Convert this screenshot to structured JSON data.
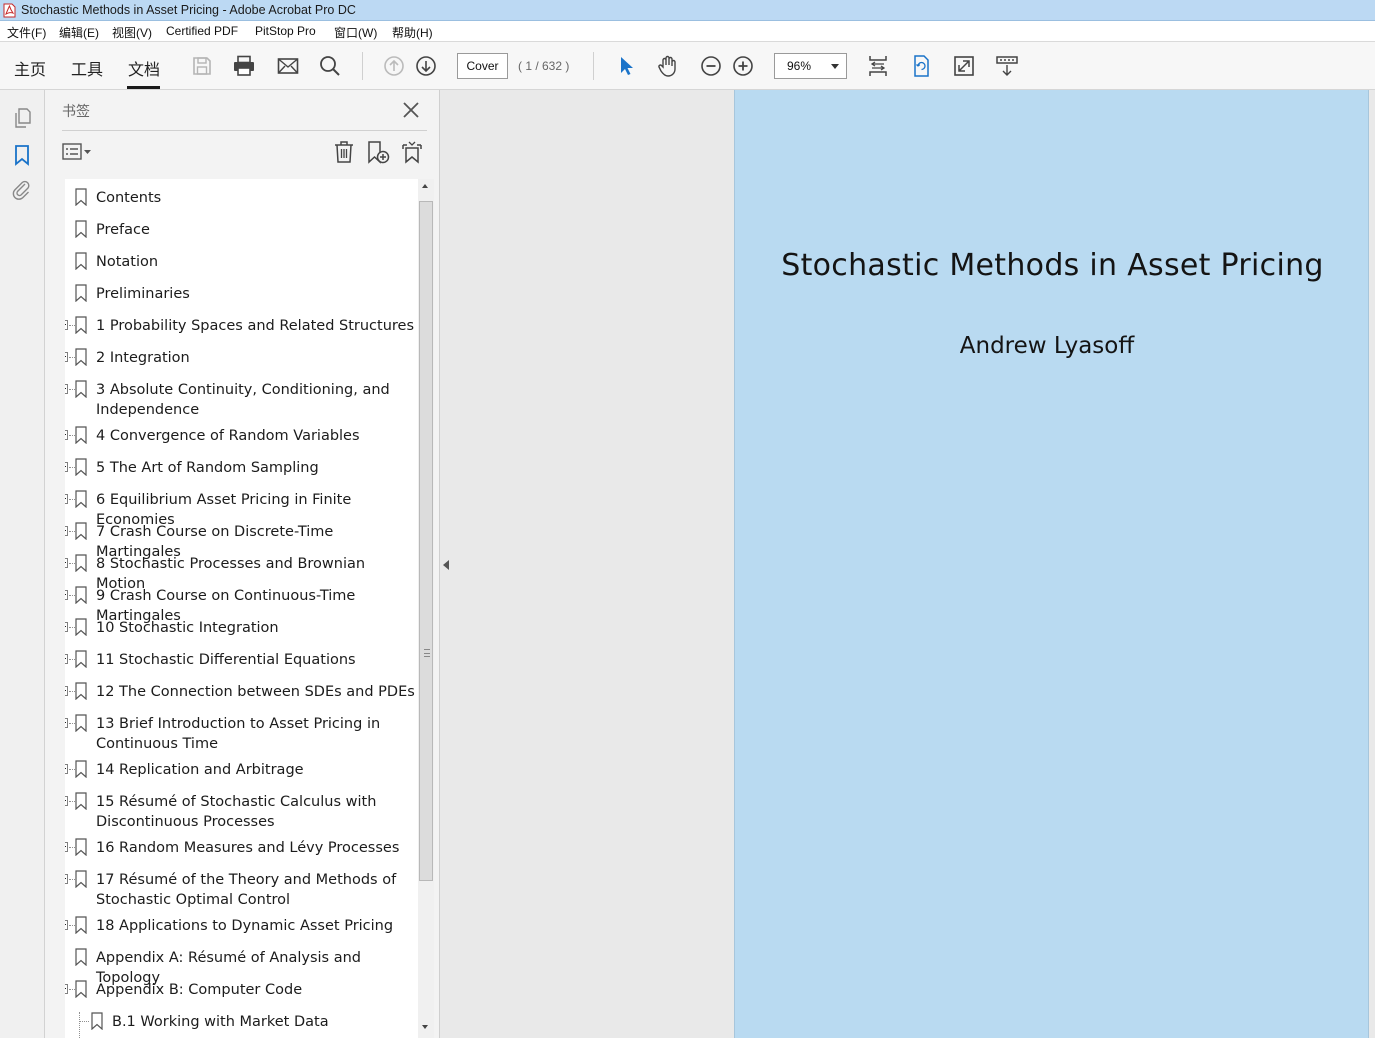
{
  "window": {
    "title": "Stochastic Methods in Asset Pricing - Adobe Acrobat Pro DC"
  },
  "menubar": {
    "items": [
      "文件(F)",
      "编辑(E)",
      "视图(V)",
      "Certified PDF",
      "PitStop Pro",
      "窗口(W)",
      "帮助(H)"
    ]
  },
  "toolbar": {
    "tabs": [
      "主页",
      "工具",
      "文档"
    ],
    "active_tab": "文档",
    "page_field_value": "Cover",
    "page_count": "( 1 / 632 )",
    "zoom": "96%",
    "icons": [
      "save-icon",
      "print-icon",
      "email-icon",
      "search-icon",
      "page-up-icon",
      "page-down-icon",
      "select-arrow-icon",
      "hand-tool-icon",
      "zoom-out-icon",
      "zoom-in-icon",
      "fit-page-icon",
      "rotate-page-icon",
      "full-screen-icon",
      "read-mode-icon"
    ]
  },
  "left_rail": {
    "icons": [
      "pages-icon",
      "bookmark-icon",
      "attachment-icon"
    ]
  },
  "bookmarks_panel": {
    "title": "书签",
    "items": [
      {
        "label": "Contents",
        "expandable": false
      },
      {
        "label": "Preface",
        "expandable": false
      },
      {
        "label": "Notation",
        "expandable": false
      },
      {
        "label": "Preliminaries",
        "expandable": false
      },
      {
        "label": "1 Probability Spaces and Related Structures",
        "expandable": true
      },
      {
        "label": "2 Integration",
        "expandable": true
      },
      {
        "label": "3 Absolute Continuity, Conditioning, and Independence",
        "expandable": true
      },
      {
        "label": "4 Convergence of Random Variables",
        "expandable": true
      },
      {
        "label": "5 The Art of Random Sampling",
        "expandable": true
      },
      {
        "label": "6 Equilibrium Asset Pricing in Finite Economies",
        "expandable": true
      },
      {
        "label": "7 Crash Course on Discrete-Time Martingales",
        "expandable": true
      },
      {
        "label": "8 Stochastic Processes and Brownian Motion",
        "expandable": true
      },
      {
        "label": "9 Crash Course on Continuous-Time Martingales",
        "expandable": true
      },
      {
        "label": "10 Stochastic Integration",
        "expandable": true
      },
      {
        "label": "11 Stochastic Differential Equations",
        "expandable": true
      },
      {
        "label": "12 The Connection between SDEs and PDEs",
        "expandable": true
      },
      {
        "label": "13 Brief Introduction to Asset Pricing in Continuous Time",
        "expandable": true
      },
      {
        "label": "14 Replication and Arbitrage",
        "expandable": true
      },
      {
        "label": "15 Résumé of Stochastic Calculus with Discontinuous Processes",
        "expandable": true
      },
      {
        "label": "16 Random Measures and Lévy Processes",
        "expandable": true
      },
      {
        "label": "17 Résumé of the Theory and Methods of Stochastic Optimal Control",
        "expandable": true
      },
      {
        "label": "18 Applications to Dynamic Asset Pricing",
        "expandable": true
      },
      {
        "label": "Appendix A: Résumé of Analysis and Topology",
        "expandable": false
      },
      {
        "label": "Appendix B: Computer Code",
        "expandable": true,
        "expanded": true
      },
      {
        "label": "B.1 Working with Market Data",
        "expandable": false,
        "child": true
      }
    ]
  },
  "document": {
    "title": "Stochastic Methods in Asset Pricing",
    "author": "Andrew Lyasoff",
    "page_color": "#b9daf1"
  }
}
